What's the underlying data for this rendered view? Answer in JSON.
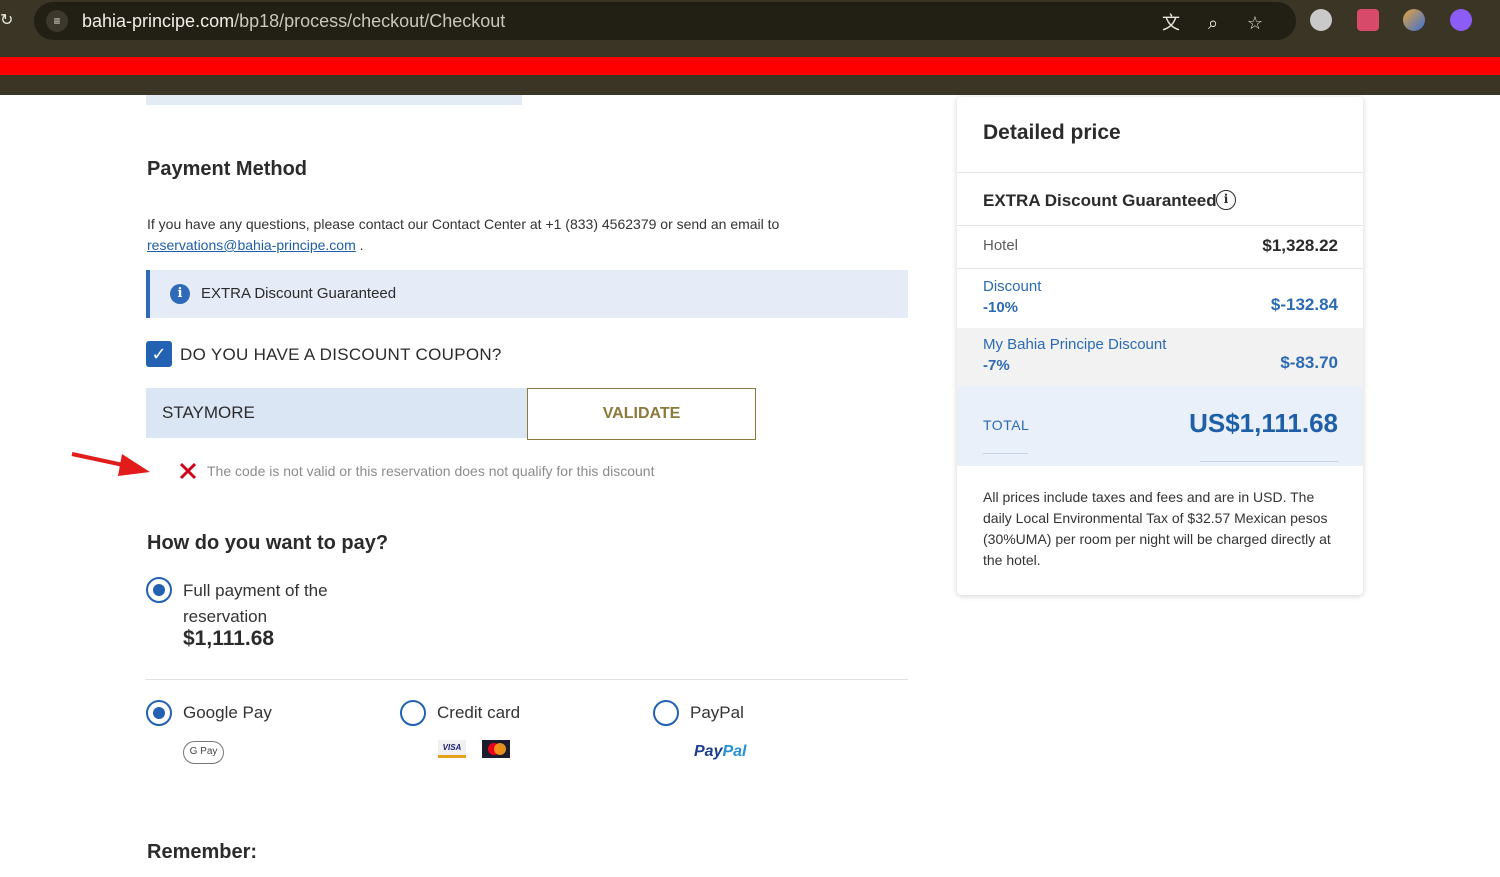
{
  "browser": {
    "url_domain": "bahia-principe.com",
    "url_path": "/bp18/process/checkout/Checkout",
    "icons": [
      "reload-icon",
      "site-info-icon",
      "translate-icon",
      "zoom-icon",
      "bookmark-star-icon",
      "extension-icon-1",
      "extension-icon-2",
      "extension-icon-3",
      "extension-icon-4"
    ]
  },
  "payment_method": {
    "title": "Payment Method",
    "contact_prefix": "If you have any questions, please contact our Contact Center at +1 (833) 4562379 or send an email to ",
    "contact_email": "reservations@bahia-principe.com",
    "contact_suffix": " ."
  },
  "banner": {
    "label": "EXTRA Discount Guaranteed"
  },
  "coupon": {
    "checkbox_label": "DO YOU HAVE A DISCOUNT COUPON?",
    "checked": true,
    "input_value": "STAYMORE",
    "validate_label": "VALIDATE",
    "error_text": "The code is not valid or this reservation does not qualify for this discount"
  },
  "pay": {
    "title": "How do you want to pay?",
    "full_payment_label": "Full payment of the reservation",
    "full_payment_amount": "$1,111.68",
    "methods": [
      {
        "label": "Google Pay",
        "selected": true,
        "badge": "G Pay"
      },
      {
        "label": "Credit card",
        "selected": false,
        "badge": "VISA"
      },
      {
        "label": "PayPal",
        "selected": false,
        "badge_pay": "Pay",
        "badge_pal": "Pal"
      }
    ]
  },
  "remember": {
    "title": "Remember:"
  },
  "price_card": {
    "title": "Detailed price",
    "extra_label": "EXTRA Discount Guaranteed",
    "hotel_label": "Hotel",
    "hotel_value": "$1,328.22",
    "discount_label": "Discount",
    "discount_pct": "-10%",
    "discount_value": "$-132.84",
    "mybahia_label": "My Bahia Principe Discount",
    "mybahia_pct": "-7%",
    "mybahia_value": "$-83.70",
    "total_label": "TOTAL",
    "total_value": "US$1,111.68",
    "note": "All prices include taxes and fees and are in USD. The daily Local Environmental Tax of $32.57 Mexican pesos (30%UMA) per room per night will be charged directly at the hotel."
  },
  "colors": {
    "brand_blue": "#2361b3",
    "gold": "#8a7a3c",
    "error_red": "#d0021b",
    "annotation_arrow": "#e21b1b"
  }
}
